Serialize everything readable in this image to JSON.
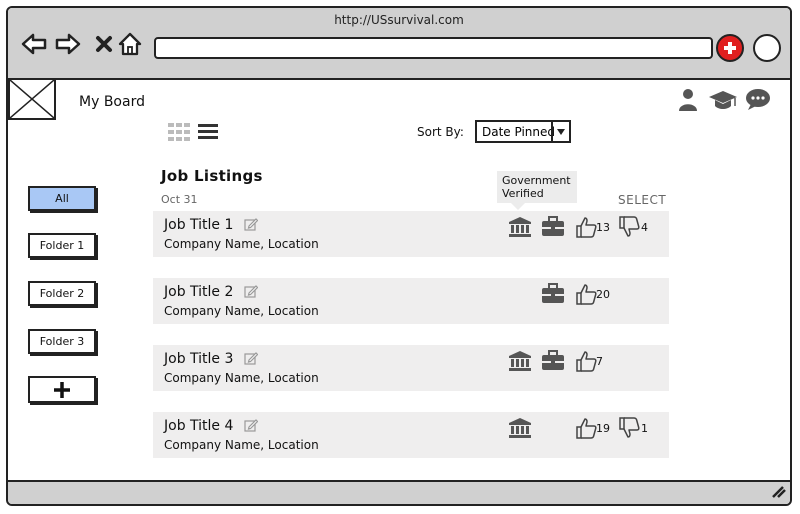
{
  "browser": {
    "url": "http://USsurvival.com"
  },
  "header": {
    "board_title": "My Board"
  },
  "toolbar": {
    "sort_label": "Sort By:",
    "sort_value": "Date Pinned"
  },
  "sidebar": {
    "folders": [
      {
        "label": "All",
        "active": true
      },
      {
        "label": "Folder 1"
      },
      {
        "label": "Folder 2"
      },
      {
        "label": "Folder 3"
      }
    ]
  },
  "main": {
    "heading": "Job Listings",
    "date": "Oct 31",
    "select_label": "SELECT",
    "tooltip": {
      "line1": "Government",
      "line2": "Verified"
    },
    "jobs": [
      {
        "title": "Job Title 1",
        "company": "Company Name, Location",
        "government": true,
        "briefcase": true,
        "likes": "13",
        "dislikes": "4"
      },
      {
        "title": "Job Title 2",
        "company": "Company Name, Location",
        "government": false,
        "briefcase": true,
        "likes": "20",
        "dislikes": ""
      },
      {
        "title": "Job Title 3",
        "company": "Company Name, Location",
        "government": true,
        "briefcase": true,
        "likes": "7",
        "dislikes": ""
      },
      {
        "title": "Job Title 4",
        "company": "Company Name, Location",
        "government": true,
        "briefcase": false,
        "likes": "19",
        "dislikes": "1"
      }
    ]
  },
  "colors": {
    "active_folder": "#a9c8f5",
    "add_button": "#e02020",
    "row_background": "#efeeee",
    "chrome": "#d0d0d0"
  }
}
